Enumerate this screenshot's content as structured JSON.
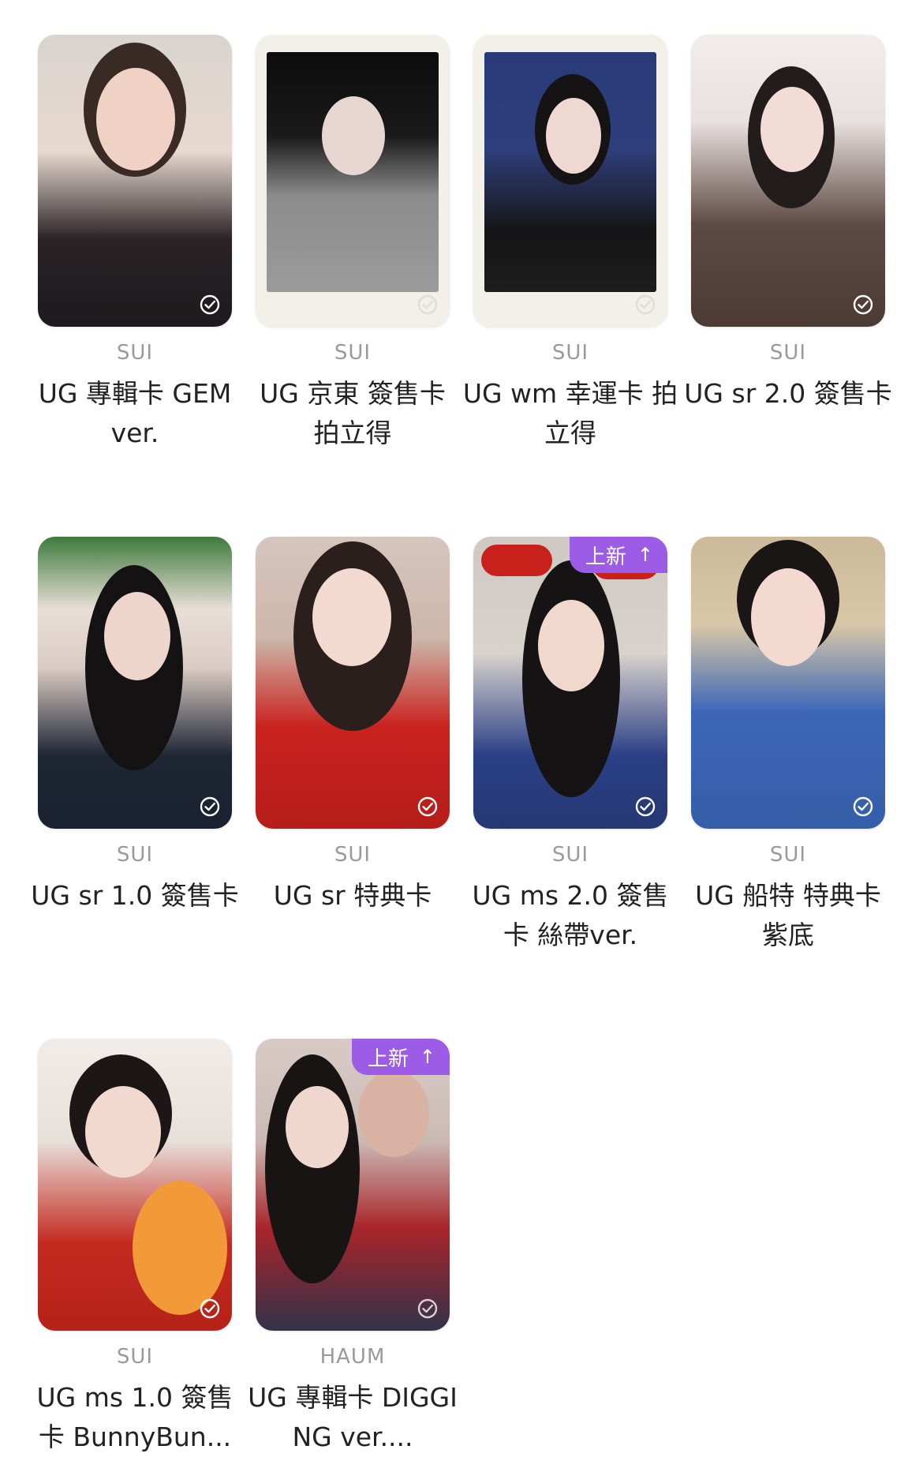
{
  "accent_color": "#9c5ce6",
  "badge_arrow_icon": "arrow-up-icon",
  "cards": [
    {
      "artist": "SUI",
      "title": "UG 專輯卡 GEM ver.",
      "new_badge": "",
      "collected": true
    },
    {
      "artist": "SUI",
      "title": "UG 京東 簽售卡 拍立得",
      "new_badge": "",
      "collected": false
    },
    {
      "artist": "SUI",
      "title": "UG wm 幸運卡 拍立得",
      "new_badge": "",
      "collected": false
    },
    {
      "artist": "SUI",
      "title": "UG sr 2.0 簽售卡",
      "new_badge": "",
      "collected": true
    },
    {
      "artist": "SUI",
      "title": "UG sr 1.0 簽售卡",
      "new_badge": "",
      "collected": true
    },
    {
      "artist": "SUI",
      "title": "UG sr 特典卡",
      "new_badge": "",
      "collected": true
    },
    {
      "artist": "SUI",
      "title": "UG ms 2.0 簽售卡 絲帶ver.",
      "new_badge": "上新",
      "collected": true
    },
    {
      "artist": "SUI",
      "title": "UG 船特 特典卡 紫底",
      "new_badge": "",
      "collected": true
    },
    {
      "artist": "SUI",
      "title": "UG ms 1.0 簽售卡 BunnyBun...",
      "new_badge": "",
      "collected": true
    },
    {
      "artist": "HAUM",
      "title": "UG 專輯卡 DIGGING ver....",
      "new_badge": "上新",
      "collected": false
    }
  ]
}
